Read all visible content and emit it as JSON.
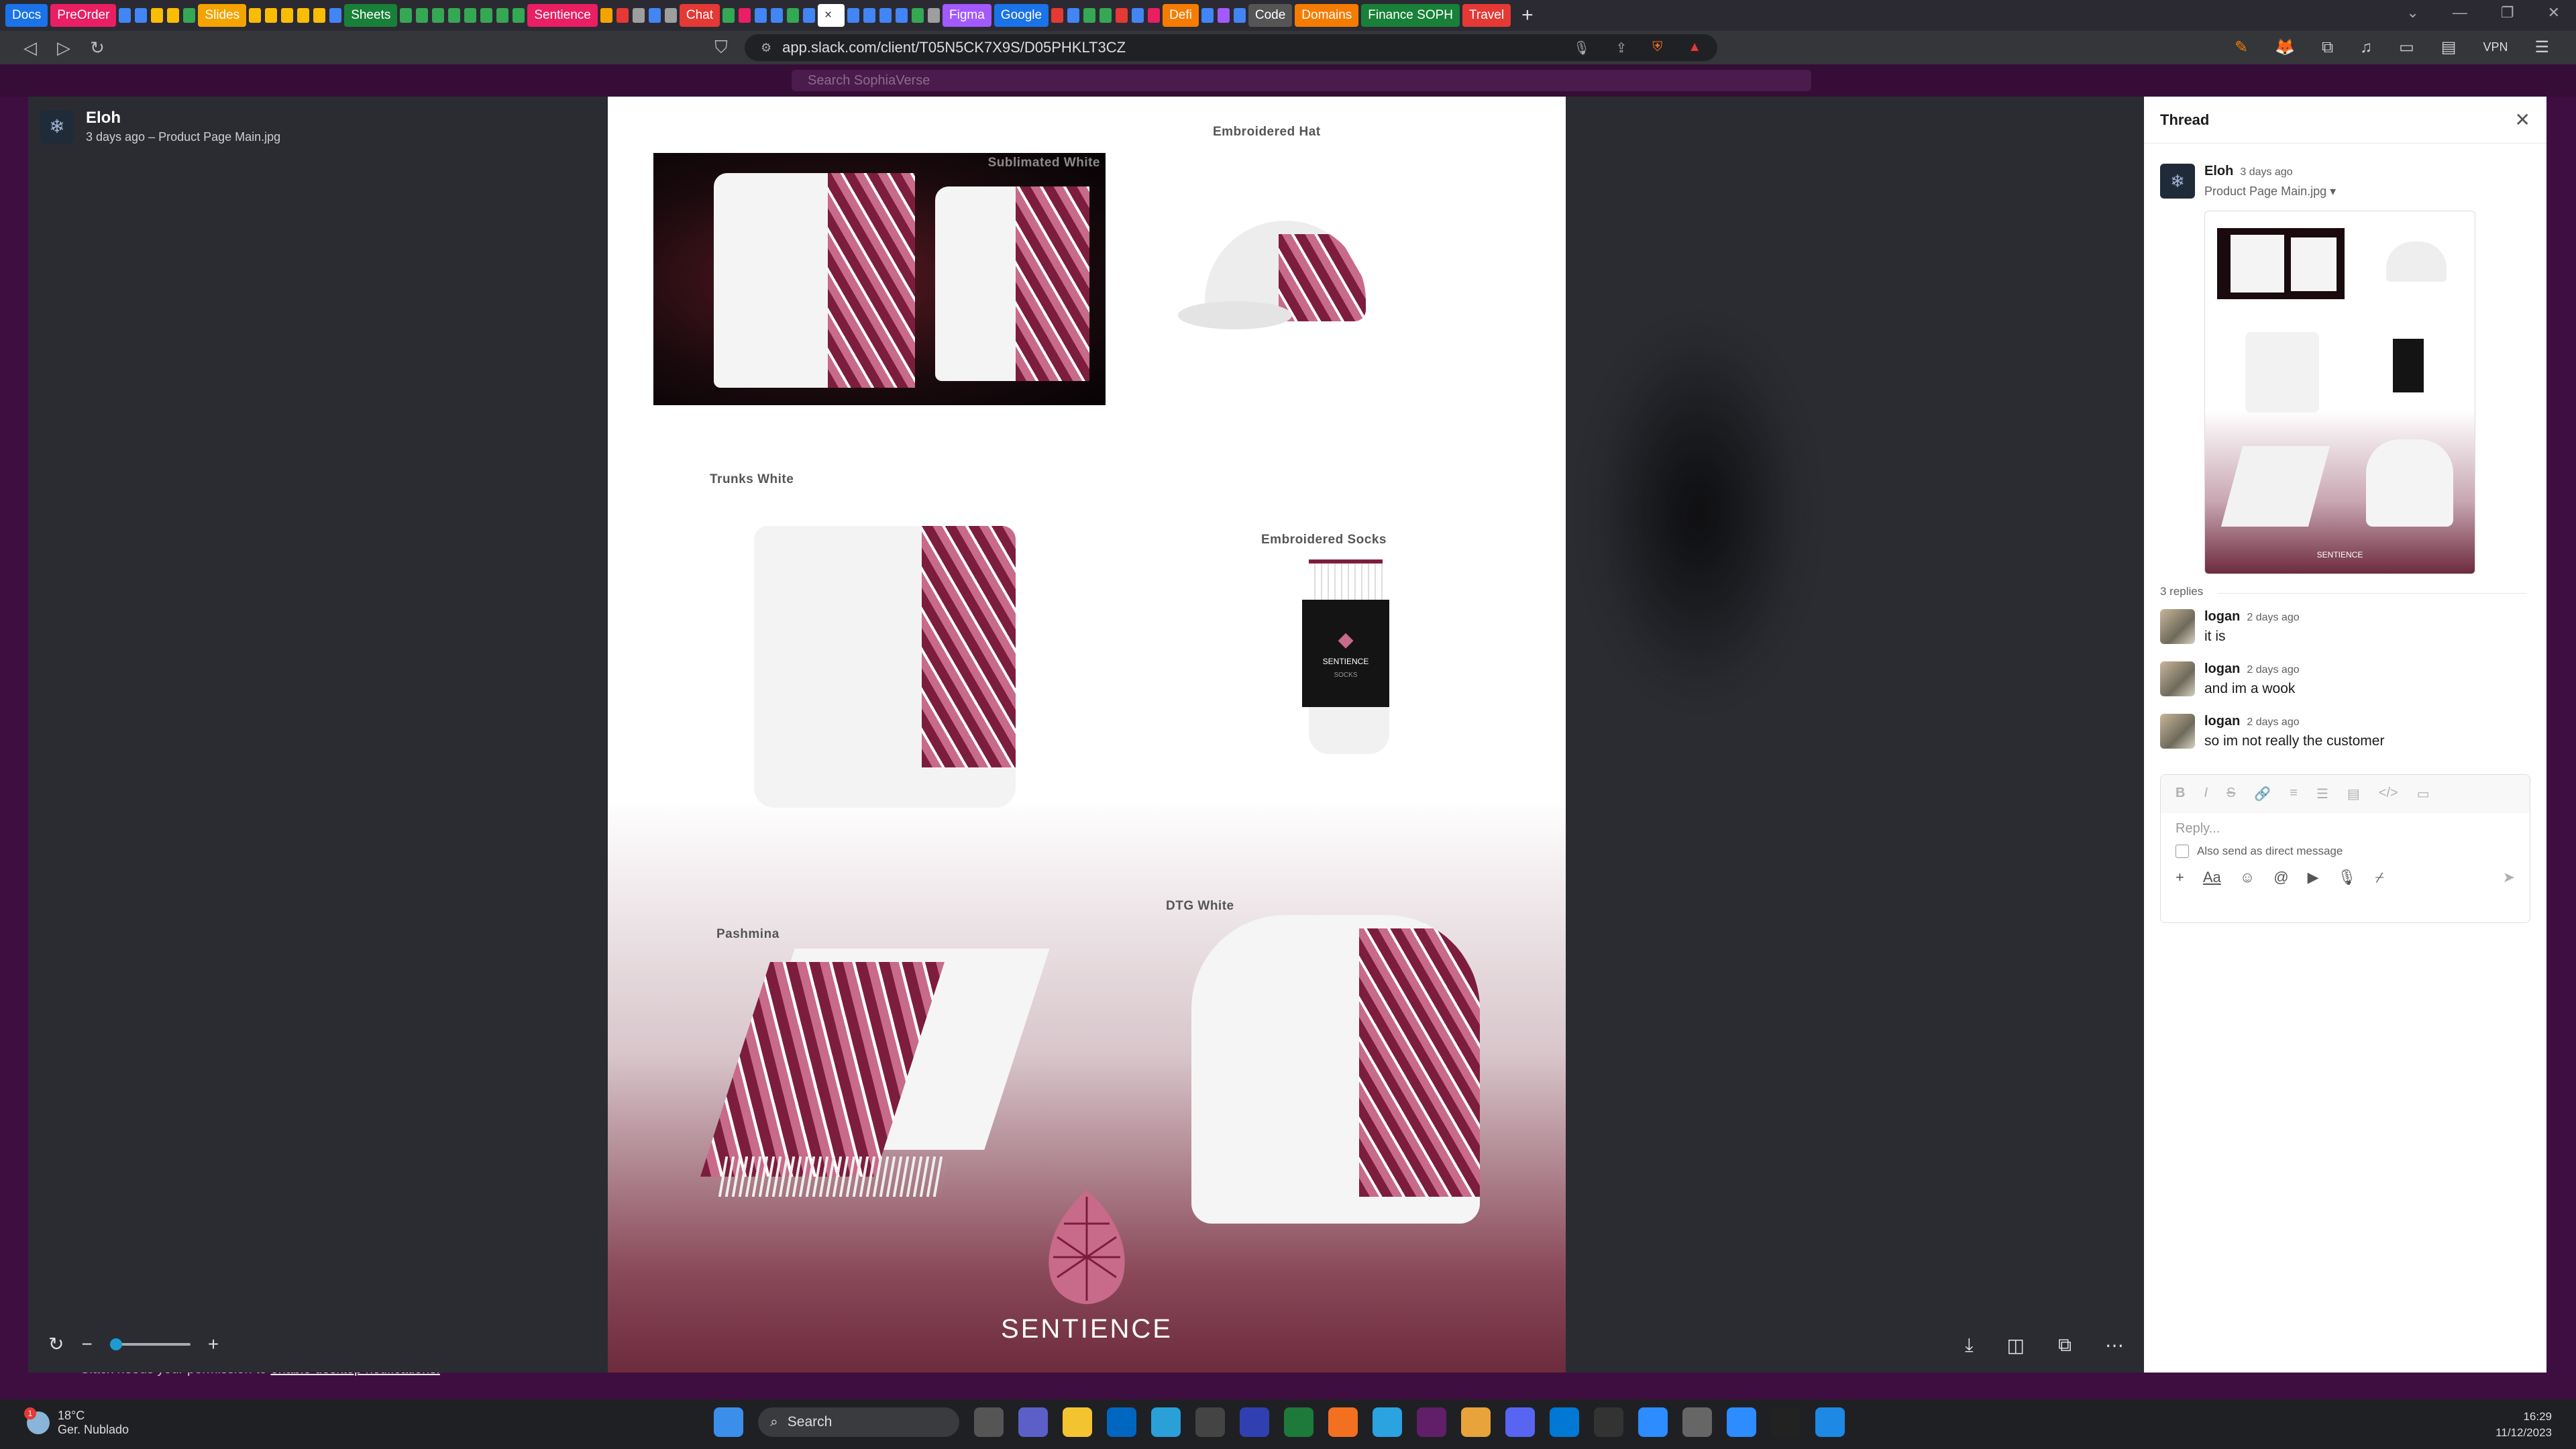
{
  "browser": {
    "tabs": [
      {
        "label": "Docs",
        "color": "#1a73e8"
      },
      {
        "label": "PreOrder",
        "color": "#e91e63"
      },
      {
        "label": "Slides",
        "color": "#f4a400"
      },
      {
        "label": "Sheets",
        "color": "#188038"
      },
      {
        "label": "Sentience",
        "color": "#e91e63"
      },
      {
        "label": "Chat",
        "color": "#e53935"
      },
      {
        "label": "Figma",
        "color": "#a259ff"
      },
      {
        "label": "Google",
        "color": "#1a73e8"
      },
      {
        "label": "Defi",
        "color": "#f57c00"
      },
      {
        "label": "Code",
        "color": "#555555"
      },
      {
        "label": "Domains",
        "color": "#f57c00"
      },
      {
        "label": "Finance SOPH",
        "color": "#188038"
      },
      {
        "label": "Travel",
        "color": "#e53935"
      }
    ],
    "url": "app.slack.com/client/T05N5CK7X9S/D05PHKLT3CZ",
    "vpn_label": "VPN"
  },
  "slack": {
    "search_placeholder": "Search SophiaVerse",
    "notification_text": "Slack needs your permission to",
    "notification_link": "enable desktop notifications."
  },
  "viewer": {
    "author": "Eloh",
    "subtitle": "3 days ago – Product Page Main.jpg",
    "image": {
      "captions": {
        "shirt": "Sublimated White",
        "hat": "Embroidered Hat",
        "trunks": "Trunks White",
        "socks": "Embroidered Socks",
        "pashmina": "Pashmina",
        "hoodie": "DTG White"
      },
      "sock_brand": "SENTIENCE",
      "sock_sub": "SOCKS",
      "brand": "SENTIENCE"
    }
  },
  "thread": {
    "title": "Thread",
    "parent": {
      "author": "Eloh",
      "time": "3 days ago",
      "file": "Product Page Main.jpg"
    },
    "thumb_brand": "SENTIENCE",
    "replies_count": "3 replies",
    "replies": [
      {
        "author": "logan",
        "time": "2 days ago",
        "text": "it is"
      },
      {
        "author": "logan",
        "time": "2 days ago",
        "text": "and im a wook"
      },
      {
        "author": "logan",
        "time": "2 days ago",
        "text": "so im not really the customer"
      }
    ],
    "composer": {
      "placeholder": "Reply...",
      "also_send": "Also send as direct message"
    }
  },
  "taskbar": {
    "weather_temp": "18°C",
    "weather_desc": "Ger. Nublado",
    "weather_badge": "1",
    "search_label": "Search",
    "time": "16:29",
    "date": "11/12/2023"
  }
}
